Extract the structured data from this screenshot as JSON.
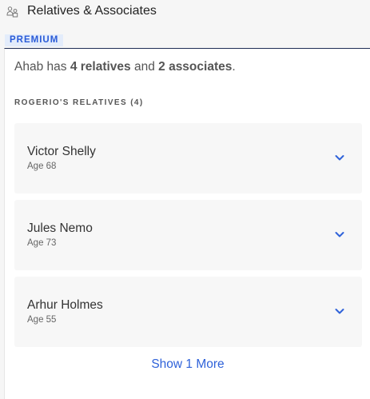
{
  "header": {
    "title": "Relatives & Associates",
    "icon": "people-icon"
  },
  "badge": {
    "label": "PREMIUM",
    "color": "#2a5bd7"
  },
  "summary": {
    "prefix": "Ahab has ",
    "relatives": "4 relatives",
    "middle": " and ",
    "associates": "2 associates",
    "suffix": "."
  },
  "section": {
    "label": "ROGERIO'S RELATIVES (4)"
  },
  "relatives": [
    {
      "name": "Victor Shelly",
      "age": "Age 68"
    },
    {
      "name": "Jules Nemo",
      "age": "Age 73"
    },
    {
      "name": "Arhur Holmes",
      "age": "Age 55"
    }
  ],
  "show_more": {
    "label": "Show 1 More"
  },
  "colors": {
    "accent": "#2f62d9",
    "card_divider": "#1f2d55"
  }
}
